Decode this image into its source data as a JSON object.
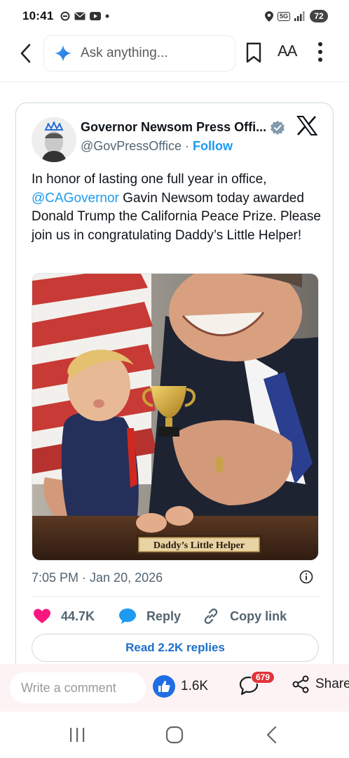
{
  "status_bar": {
    "time": "10:41",
    "network": "5G",
    "battery": "72"
  },
  "toolbar": {
    "search_placeholder": "Ask anything...",
    "text_size_label": "AA"
  },
  "tweet": {
    "author_name": "Governor Newsom Press Offi...",
    "handle": "@GovPressOffice",
    "separator": " · ",
    "follow_label": "Follow",
    "text_part1": "In honor of lasting one full year in office, ",
    "mention": "@CAGovernor",
    "text_part2": " Gavin Newsom today awarded Donald Trump the California Peace Prize. Please join us in congratulating Daddy’s Little Helper!",
    "image_plaque": "Daddy’s Little Helper",
    "timestamp": "7:05 PM · Jan 20, 2026",
    "likes": "44.7K",
    "reply_label": "Reply",
    "copy_link_label": "Copy link",
    "read_replies_label": "Read 2.2K replies"
  },
  "comment_bar": {
    "placeholder": "Write a comment",
    "likes_count": "1.6K",
    "comments_badge": "679",
    "share_label": "Share"
  },
  "colors": {
    "twitter_blue": "#1d9bf0",
    "like_red": "#f91880",
    "reaction_blue": "#1f6ee5",
    "badge_red": "#e2353b"
  }
}
